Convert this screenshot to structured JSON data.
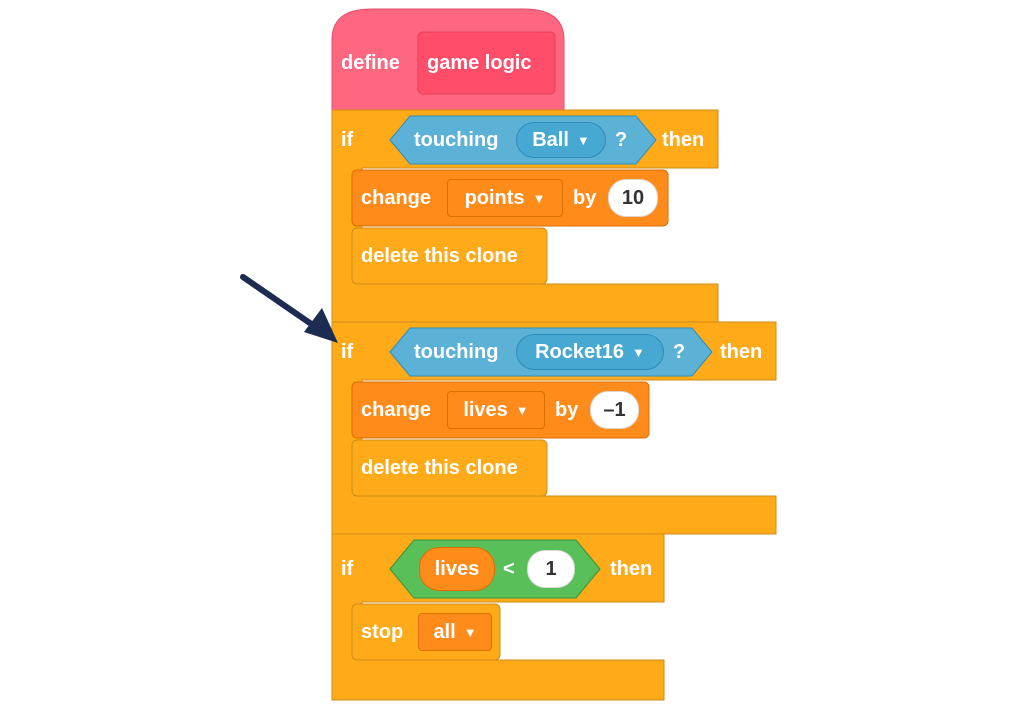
{
  "define_block": {
    "keyword": "define",
    "name": "game logic"
  },
  "if_blocks": [
    {
      "if_label": "if",
      "condition": {
        "word": "touching",
        "object": "Ball",
        "question": "?"
      },
      "then_label": "then",
      "change_block": {
        "keyword": "change",
        "variable": "points",
        "by_label": "by",
        "value": "10"
      },
      "delete_block": {
        "label": "delete this clone"
      }
    },
    {
      "if_label": "if",
      "condition": {
        "word": "touching",
        "object": "Rocket16",
        "question": "?"
      },
      "then_label": "then",
      "change_block": {
        "keyword": "change",
        "variable": "lives",
        "by_label": "by",
        "value": "–1"
      },
      "delete_block": {
        "label": "delete this clone"
      }
    },
    {
      "if_label": "if",
      "condition": {
        "variable": "lives",
        "operator": "<",
        "value": "1"
      },
      "then_label": "then",
      "stop_block": {
        "keyword": "stop",
        "option": "all"
      }
    }
  ],
  "icons": {
    "dropdown": "dropdown-arrow-icon",
    "pointer": "pointer-arrow-icon"
  },
  "colors": {
    "define": "#ff6680",
    "define_inner": "#ff4d6a",
    "control": "#ffab19",
    "control_border": "#cf8b17",
    "variables": "#ff8c1a",
    "variables_border": "#db6e00",
    "sensing": "#5cb1d6",
    "sensing_border": "#2e8eb8",
    "operators": "#59c059",
    "operators_border": "#389438",
    "arrow": "#1c2b52"
  }
}
